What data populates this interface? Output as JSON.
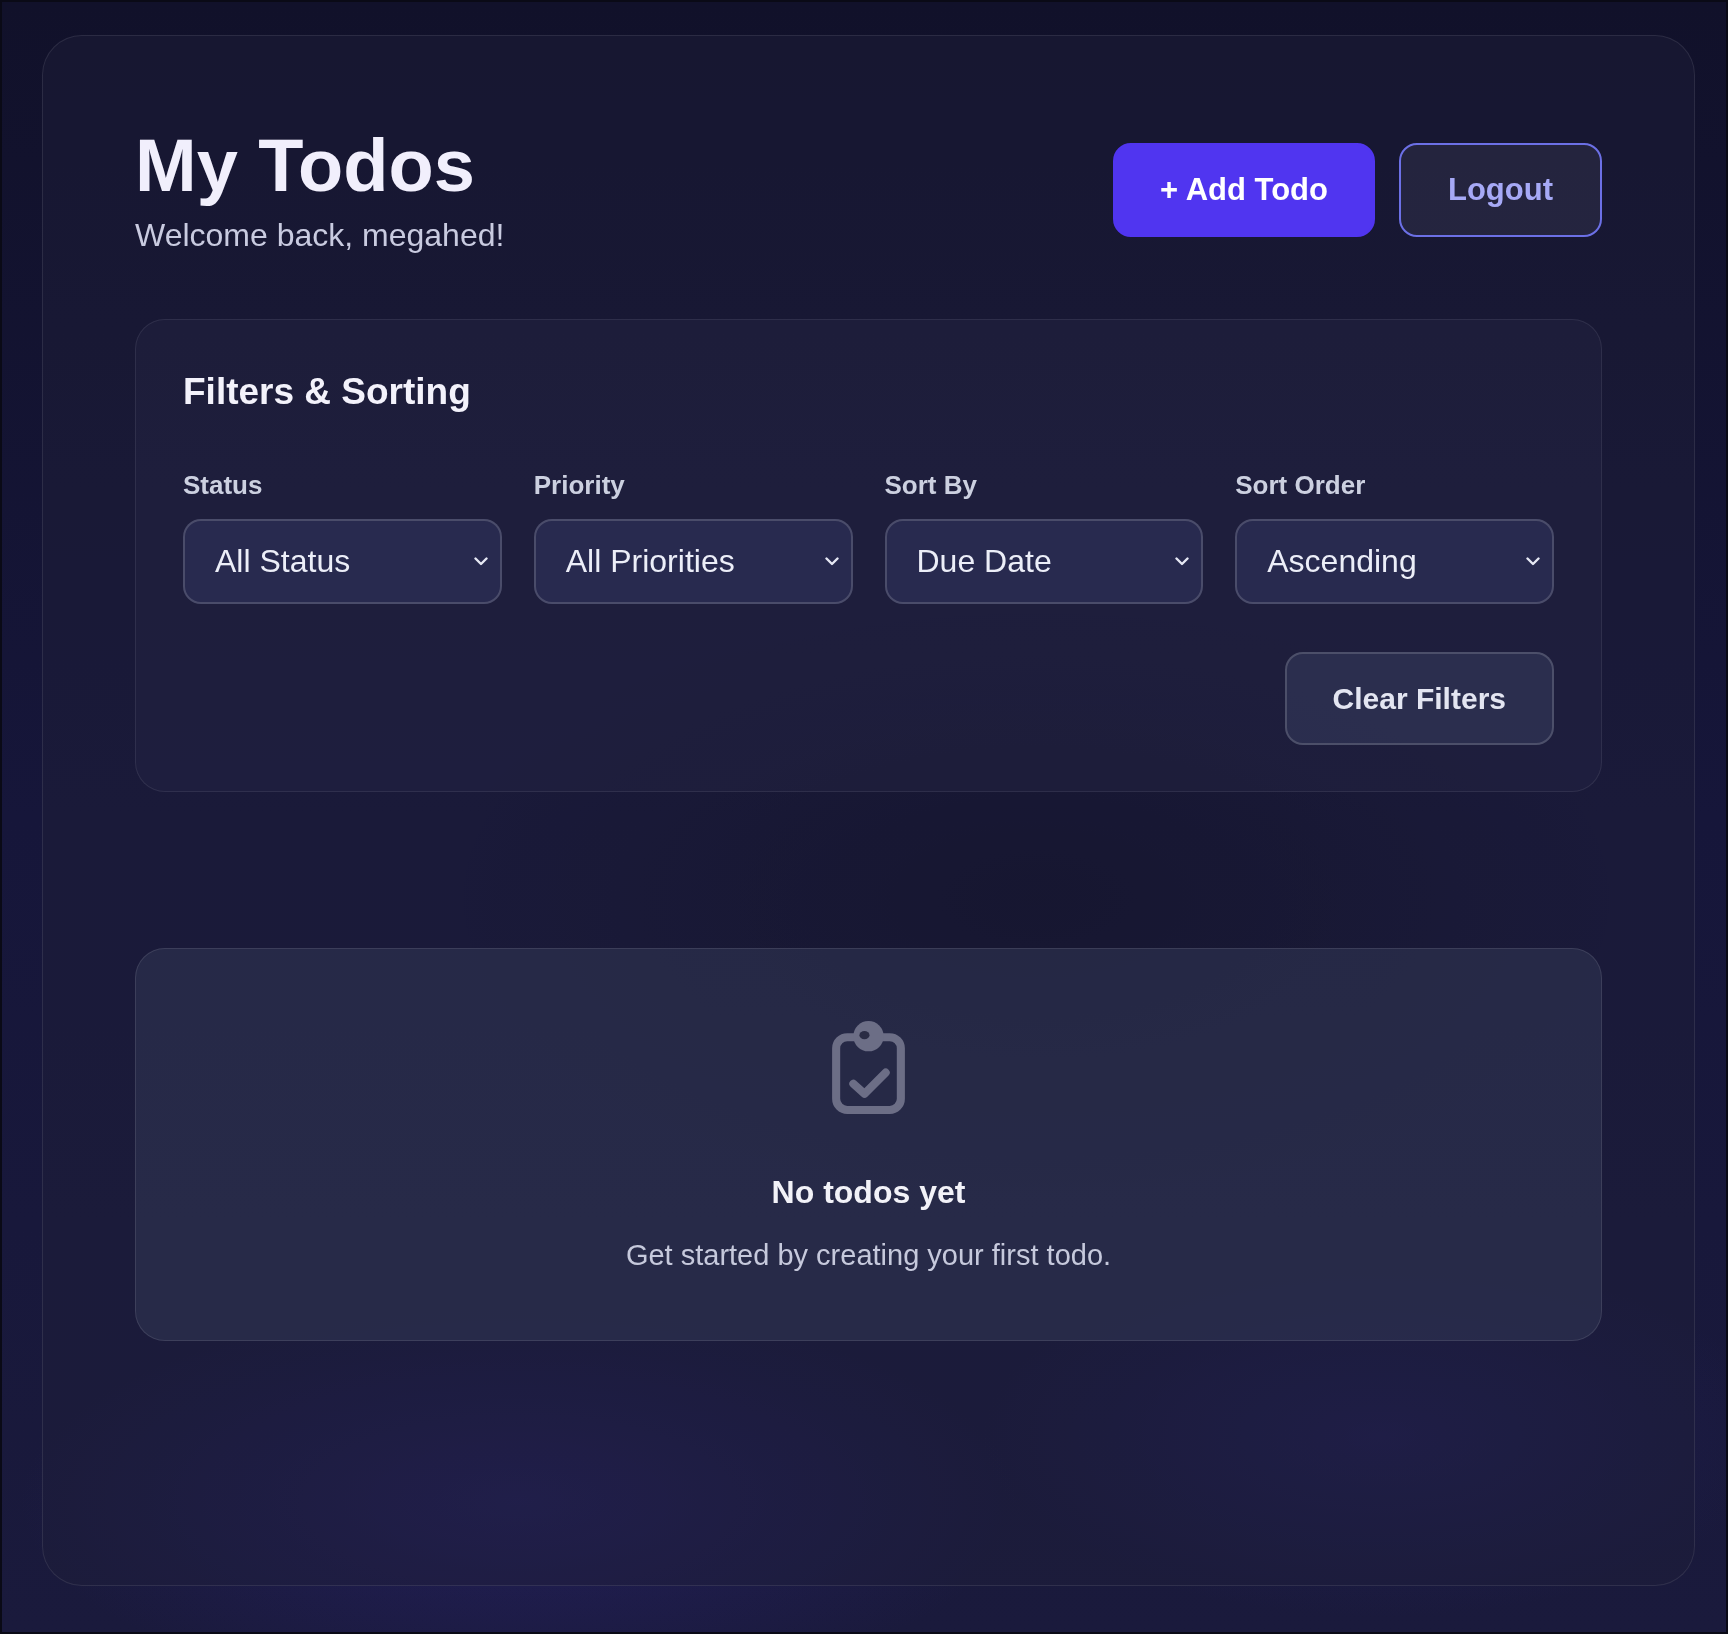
{
  "header": {
    "title": "My Todos",
    "subtitle": "Welcome back, megahed!",
    "buttons": [
      {
        "label": "+ Add Todo",
        "kind": "primary"
      },
      {
        "label": "Logout",
        "kind": "outline"
      }
    ]
  },
  "filters": {
    "title": "Filters & Sorting",
    "fields": [
      {
        "label": "Status",
        "value": "All Status"
      },
      {
        "label": "Priority",
        "value": "All Priorities"
      },
      {
        "label": "Sort By",
        "value": "Due Date"
      },
      {
        "label": "Sort Order",
        "value": "Ascending"
      }
    ],
    "clear_button": "Clear Filters"
  },
  "empty_state": {
    "title": "No todos yet",
    "message": "Get started by creating your first todo."
  }
}
